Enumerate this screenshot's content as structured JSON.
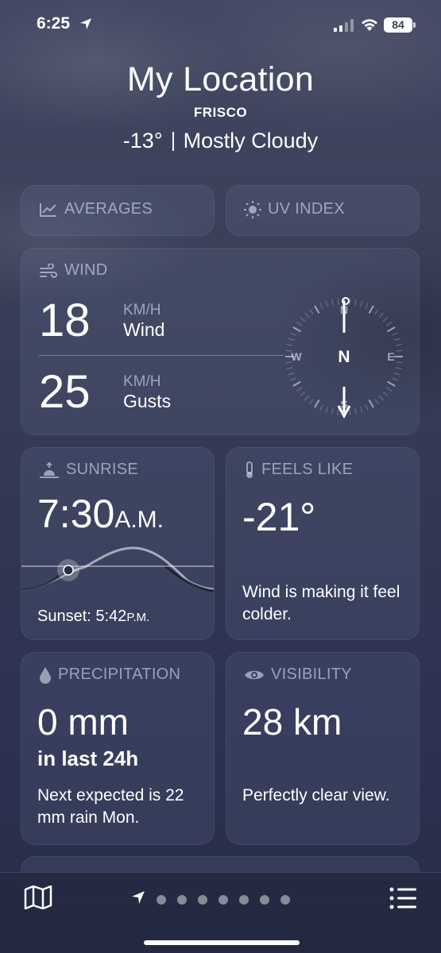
{
  "status_bar": {
    "time": "6:25",
    "battery": "84"
  },
  "header": {
    "title": "My Location",
    "subtitle": "FRISCO",
    "temperature": "-13°",
    "condition": "Mostly Cloudy"
  },
  "cards": {
    "averages": {
      "label": "AVERAGES"
    },
    "uv_index": {
      "label": "UV INDEX"
    },
    "wind": {
      "label": "WIND",
      "wind_value": "18",
      "wind_unit": "KM/H",
      "wind_label": "Wind",
      "gust_value": "25",
      "gust_unit": "KM/H",
      "gust_label": "Gusts",
      "compass": {
        "n": "N",
        "e": "E",
        "s": "S",
        "w": "W",
        "center": "N"
      }
    },
    "sunrise": {
      "label": "SUNRISE",
      "time": "7:30",
      "ampm": "A.M.",
      "sunset_label": "Sunset: 5:42",
      "sunset_ampm": "P.M."
    },
    "feels_like": {
      "label": "FEELS LIKE",
      "value": "-21°",
      "note": "Wind is making it feel colder."
    },
    "precipitation": {
      "label": "PRECIPITATION",
      "value": "0 mm",
      "period": "in last 24h",
      "note": "Next expected is 22 mm rain Mon."
    },
    "visibility": {
      "label": "VISIBILITY",
      "value": "28 km",
      "note": "Perfectly clear view."
    }
  },
  "bottom_bar": {
    "page_count": 8,
    "current_page": 0
  }
}
